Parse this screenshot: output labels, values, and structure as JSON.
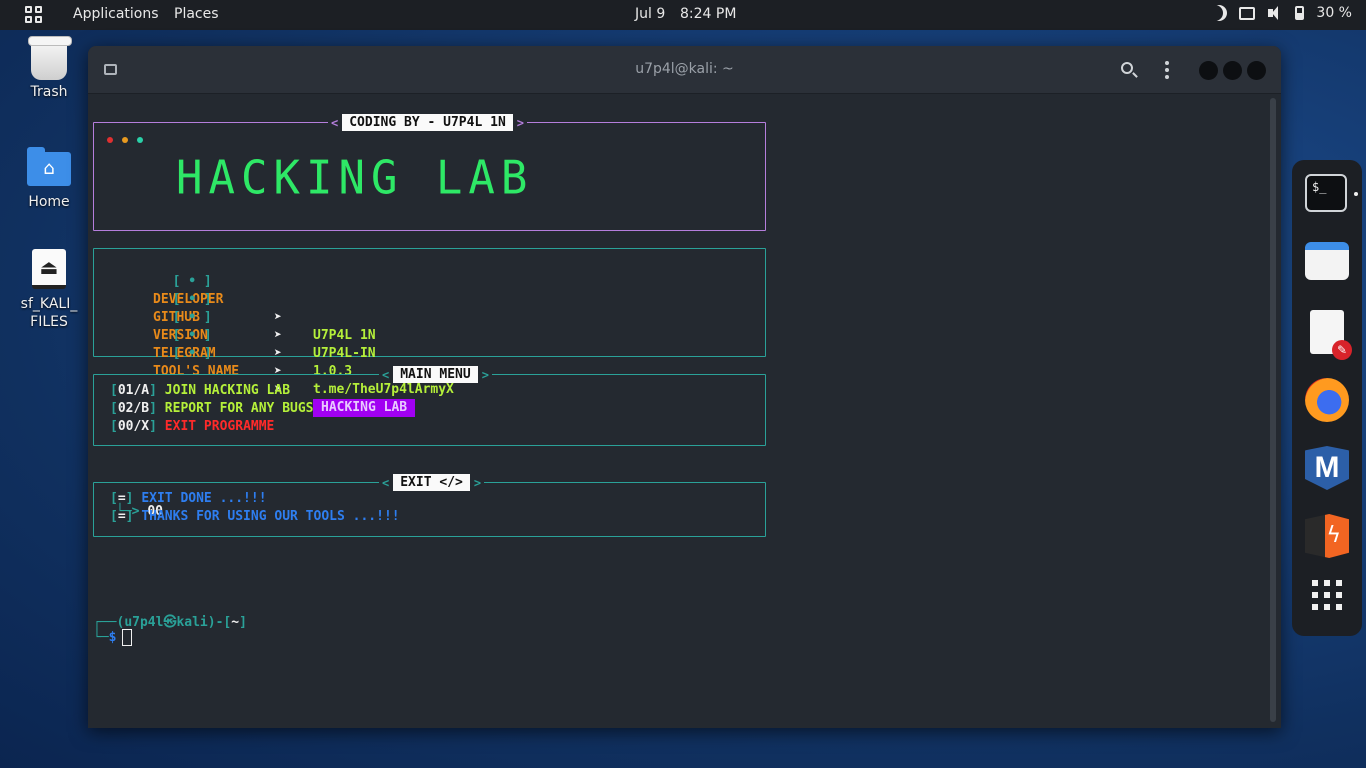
{
  "topbar": {
    "applications": "Applications",
    "places": "Places",
    "date": "Jul 9",
    "time": "8:24 PM",
    "battery": "30 %"
  },
  "desktop": {
    "trash": "Trash",
    "home": "Home",
    "drive": "sf_KALI_ FILES"
  },
  "window": {
    "title": "u7p4l@kali: ~"
  },
  "terminal": {
    "banner_title_box": "CODING BY - U7P4L 1N",
    "banner": "HACKING LAB",
    "info": [
      {
        "bullet": "[ • ]",
        "key": "DEVELOPER",
        "arrow": "➤",
        "value": "U7P4L 1N"
      },
      {
        "bullet": "[ • ]",
        "key": "GITHUB",
        "arrow": "➤",
        "value": "U7P4L-IN"
      },
      {
        "bullet": "[ • ]",
        "key": "VERSION",
        "arrow": "➤",
        "value": "1.0.3"
      },
      {
        "bullet": "[ • ]",
        "key": "TELEGRAM",
        "arrow": "➤",
        "value": "t.me/TheU7p4lArmyX"
      },
      {
        "bullet": "[ • ]",
        "key": "TOOL'S NAME",
        "arrow": "➤",
        "value": "HACKING LAB"
      }
    ],
    "main_menu_title": "MAIN MENU",
    "menu": [
      {
        "num": "01/A",
        "label": "JOIN HACKING LAB"
      },
      {
        "num": "02/B",
        "label": "REPORT FOR ANY BUGS"
      },
      {
        "num": "00/X",
        "label": "EXIT PROGRAMME"
      }
    ],
    "input_arrow": "└─>",
    "input_value": "00",
    "exit_title": "EXIT </>",
    "exit_lines": [
      {
        "mark": "=",
        "text": "EXIT DONE ...!!!"
      },
      {
        "mark": "=",
        "text": "THANKS FOR USING OUR TOOLS ...!!!"
      }
    ],
    "prompt_line1_prefix": "┌──(",
    "prompt_user": "u7p4l㉿kali",
    "prompt_mid": ")-[",
    "prompt_dir": "~",
    "prompt_end": "]",
    "prompt_line2_prefix": "└─",
    "prompt_symbol": "$"
  },
  "colors": {
    "accent_teal": "#2aa198",
    "banner_green": "#2ee866",
    "key_orange": "#e88a1a",
    "value_lime": "#b5f03a",
    "exit_red": "#ff2a2a",
    "exit_blue": "#2e7ef0",
    "tag_purple": "#a100f2"
  },
  "dock": [
    "terminal-icon",
    "files-icon",
    "text-editor-icon",
    "firefox-icon",
    "metasploit-icon",
    "burpsuite-icon",
    "show-apps-icon"
  ]
}
